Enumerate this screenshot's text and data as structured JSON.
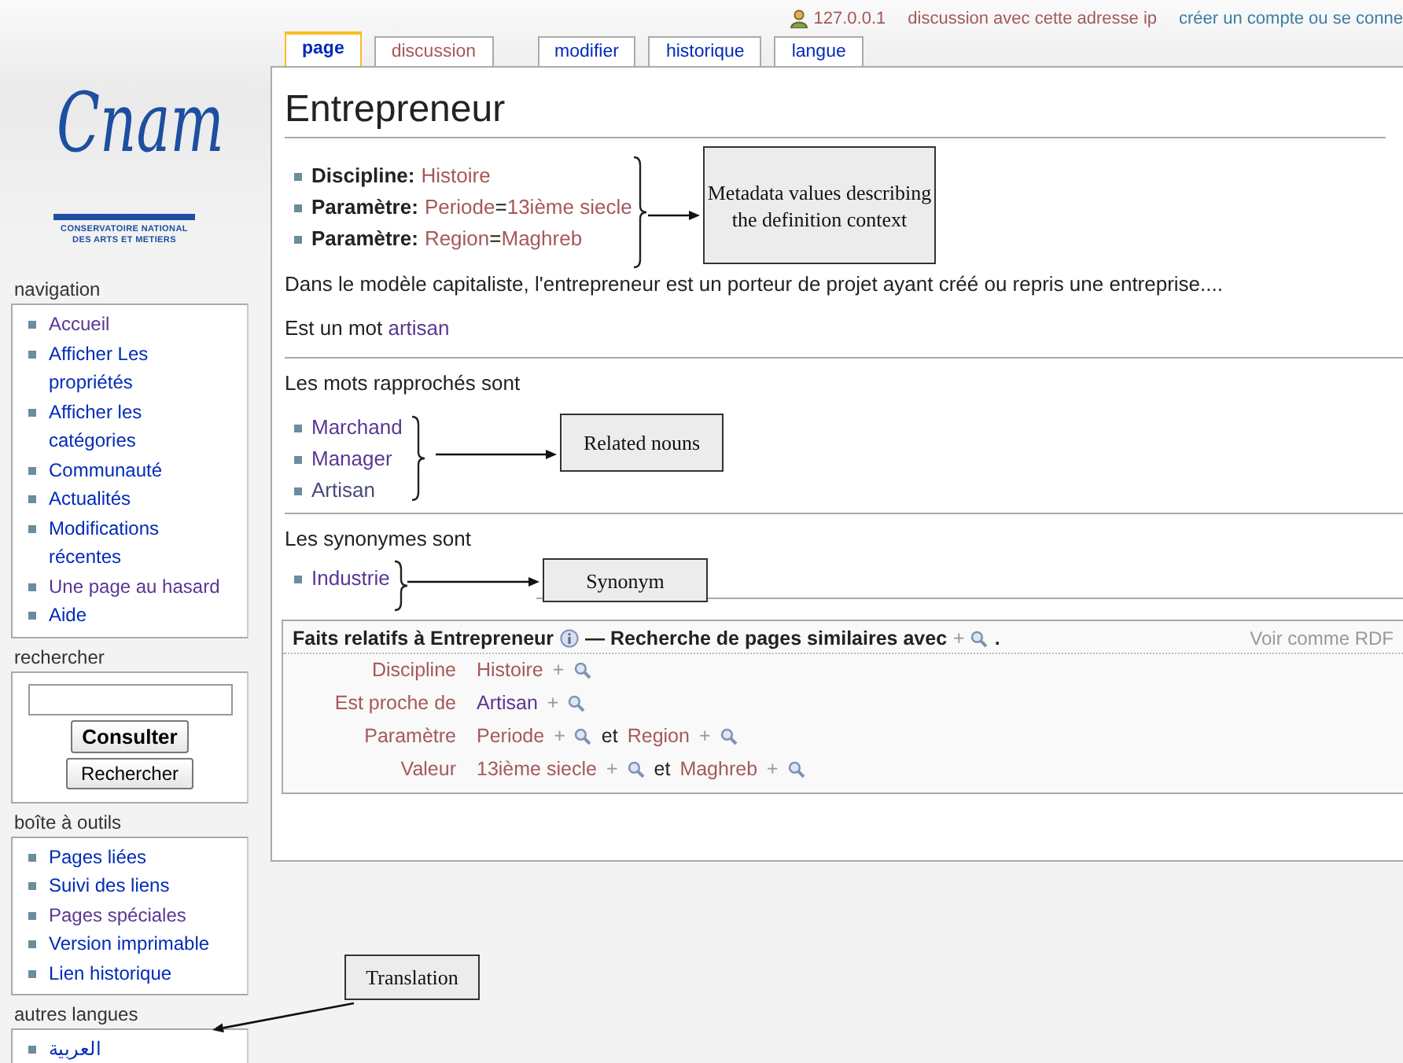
{
  "personal_bar": {
    "ip": "127.0.0.1",
    "links": [
      {
        "label": "discussion avec cette adresse ip",
        "new": true
      },
      {
        "label": "créer un compte ou se conne",
        "new": false
      }
    ]
  },
  "logo": {
    "wordmark": "Cnam",
    "subtitle": [
      "CONSERVATOIRE NATIONAL",
      "DES ARTS ET METIERS"
    ]
  },
  "tabs": [
    {
      "label": "page",
      "selected": true,
      "new": false,
      "kind": "namespace"
    },
    {
      "label": "discussion",
      "selected": false,
      "new": true,
      "kind": "namespace"
    },
    {
      "label": "modifier",
      "selected": false,
      "new": false,
      "kind": "action"
    },
    {
      "label": "historique",
      "selected": false,
      "new": false,
      "kind": "action"
    },
    {
      "label": "langue",
      "selected": false,
      "new": false,
      "kind": "action"
    }
  ],
  "sidebar": [
    {
      "kind": "links",
      "title": "navigation",
      "items": [
        {
          "label": "Accueil",
          "visited": true
        },
        {
          "label": "Afficher Les propriétés",
          "visited": false
        },
        {
          "label": "Afficher les catégories",
          "visited": false
        },
        {
          "label": "Communauté",
          "visited": false
        },
        {
          "label": "Actualités",
          "visited": false
        },
        {
          "label": "Modifications récentes",
          "visited": false
        },
        {
          "label": "Une page au hasard",
          "visited": true
        },
        {
          "label": "Aide",
          "visited": false
        }
      ]
    },
    {
      "kind": "search",
      "title": "rechercher",
      "buttons": [
        "Consulter",
        "Rechercher"
      ]
    },
    {
      "kind": "links",
      "title": "boîte à outils",
      "items": [
        {
          "label": "Pages liées",
          "visited": false
        },
        {
          "label": "Suivi des liens",
          "visited": false
        },
        {
          "label": "Pages spéciales",
          "visited": true
        },
        {
          "label": "Version imprimable",
          "visited": false
        },
        {
          "label": "Lien historique",
          "visited": false
        }
      ]
    },
    {
      "kind": "links",
      "title": "autres langues",
      "items": [
        {
          "label": "العربية",
          "visited": false
        }
      ]
    }
  ],
  "article": {
    "title": "Entrepreneur",
    "metadata": [
      {
        "label": "Discipline:",
        "value": [
          {
            "text": "Histoire",
            "link": true
          }
        ]
      },
      {
        "label": "Paramètre:",
        "value": [
          {
            "text": "Periode",
            "link": true
          },
          {
            "text": "=",
            "link": false
          },
          {
            "text": "13ième siecle",
            "link": true
          }
        ]
      },
      {
        "label": "Paramètre:",
        "value": [
          {
            "text": "Region",
            "link": true
          },
          {
            "text": "=",
            "link": false
          },
          {
            "text": "Maghreb",
            "link": true
          }
        ]
      }
    ],
    "definition": "Dans le modèle capitaliste, l'entrepreneur est un porteur de projet ayant créé ou repris une entreprise....",
    "is_a": {
      "text": "Est un mot",
      "link": "artisan"
    },
    "related": {
      "heading": "Les mots rapprochés sont",
      "items": [
        {
          "label": "Marchand",
          "visited": true
        },
        {
          "label": "Manager",
          "visited": true
        },
        {
          "label": "Artisan",
          "visited": false
        }
      ]
    },
    "synonyms": {
      "heading": "Les synonymes sont",
      "items": [
        {
          "label": "Industrie",
          "visited": true
        }
      ]
    }
  },
  "facts": {
    "title": "Faits relatifs à Entrepreneur",
    "search_text": "— Recherche de pages similaires avec",
    "plus": "+",
    "end": ".",
    "rdf": "Voir comme RDF",
    "rows": [
      {
        "property": "Discipline",
        "values": [
          {
            "text": "Histoire",
            "new": true,
            "plus": "+"
          }
        ]
      },
      {
        "property": "Est proche de",
        "values": [
          {
            "text": "Artisan",
            "new": false,
            "plus": "+"
          }
        ]
      },
      {
        "property": "Paramètre",
        "values": [
          {
            "text": "Periode",
            "new": true,
            "plus": "+"
          },
          {
            "conjunction": "et",
            "text": "Region",
            "new": true,
            "plus": "+"
          }
        ]
      },
      {
        "property": "Valeur",
        "values": [
          {
            "text": "13ième siecle",
            "new": true,
            "plus": "+"
          },
          {
            "conjunction": "et",
            "text": "Maghreb",
            "new": true,
            "plus": "+"
          }
        ]
      }
    ]
  },
  "annotations": [
    {
      "text": "Metadata values describing the definition context"
    },
    {
      "text": "Related nouns"
    },
    {
      "text": "Synonym"
    },
    {
      "text": "Translation"
    }
  ]
}
